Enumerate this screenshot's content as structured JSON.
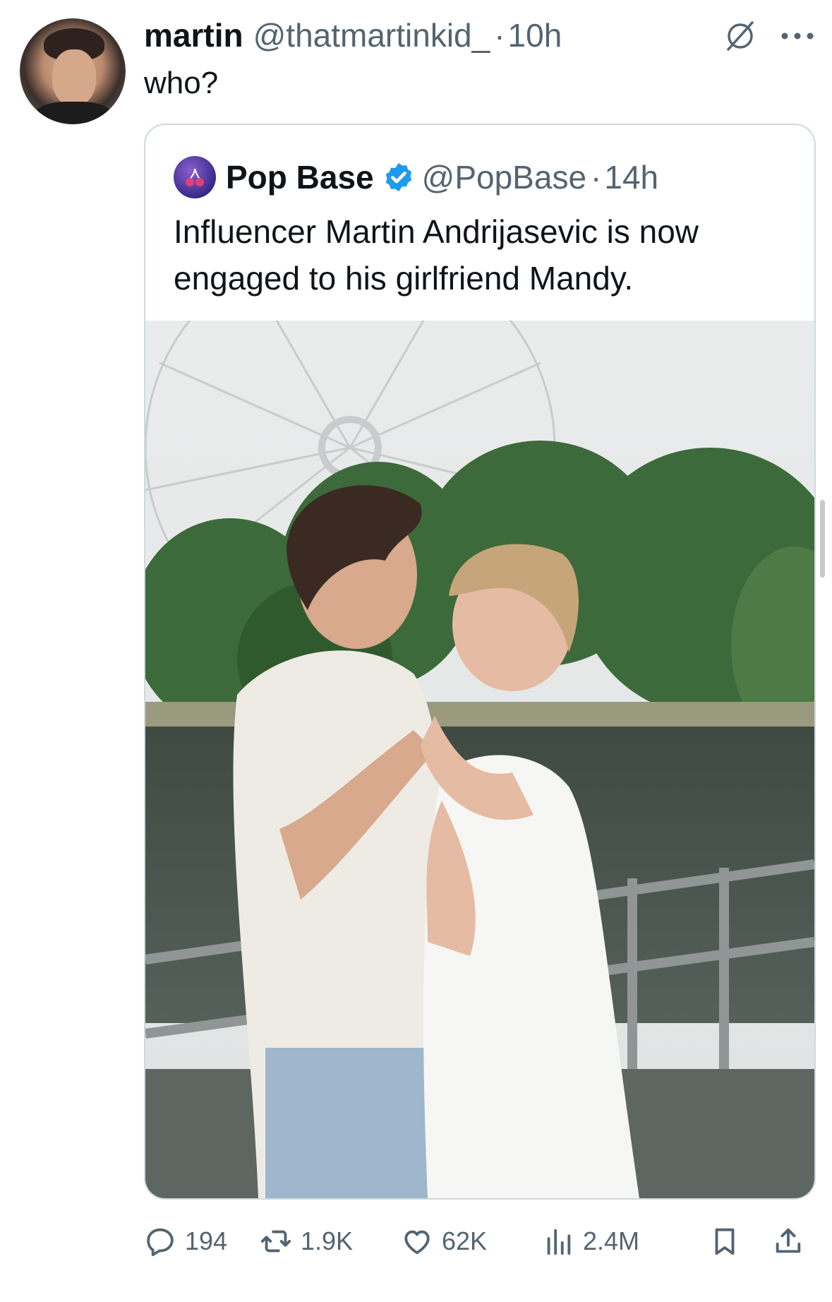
{
  "tweet": {
    "display_name": "martin",
    "handle": "@thatmartinkid_",
    "separator": "·",
    "time": "10h",
    "text": "who?"
  },
  "quote": {
    "display_name": "Pop Base",
    "handle": "@PopBase",
    "separator": "·",
    "time": "14h",
    "text": "Influencer Martin Andrijasevic is now engaged to his girlfriend Mandy.",
    "verified_color": "#1d9bf0",
    "photo_description_icon": "couple-photo"
  },
  "actions": {
    "replies": "194",
    "reposts": "1.9K",
    "likes": "62K",
    "views": "2.4M"
  },
  "colors": {
    "text_primary": "#0f1419",
    "text_secondary": "#536471",
    "border": "#cfd9de",
    "verified": "#1d9bf0"
  }
}
